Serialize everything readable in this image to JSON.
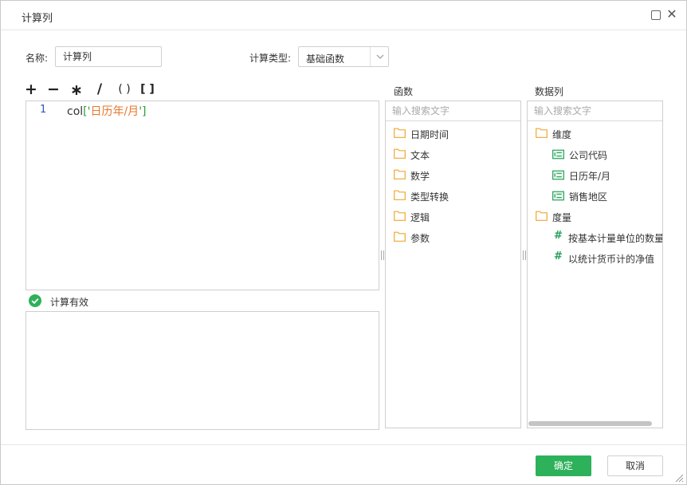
{
  "window": {
    "title": "计算列"
  },
  "form": {
    "name_label": "名称:",
    "name_value": "计算列",
    "type_label": "计算类型:",
    "type_value": "基础函数"
  },
  "operators": [
    "+",
    "−",
    "∗",
    "/",
    "( )",
    "[ ]"
  ],
  "editor": {
    "line_number": "1",
    "code_func": "col",
    "code_open": "['",
    "code_field": "日历年/月",
    "code_close": "']"
  },
  "status": {
    "text": "计算有效",
    "color": "#2db15a"
  },
  "functions_panel": {
    "title": "函数",
    "search_placeholder": "输入搜索文字",
    "items": [
      "日期时间",
      "文本",
      "数学",
      "类型转换",
      "逻辑",
      "参数"
    ]
  },
  "columns_panel": {
    "title": "数据列",
    "search_placeholder": "输入搜索文字",
    "dimension_group": "维度",
    "dimensions": [
      "公司代码",
      "日历年/月",
      "销售地区"
    ],
    "measure_group": "度量",
    "measures": [
      "按基本计量单位的数量",
      "以统计货币计的净值"
    ]
  },
  "footer": {
    "ok_label": "确定",
    "cancel_label": "取消"
  },
  "icons": {
    "folder": "folder-icon",
    "dimension": "dimension-field-icon",
    "measure": "hash-icon",
    "status": "check-circle-icon"
  },
  "colors": {
    "accent": "#2db15a",
    "folder": "#f0a830",
    "string": "#e8772e",
    "line_number": "#2b5bb5"
  }
}
